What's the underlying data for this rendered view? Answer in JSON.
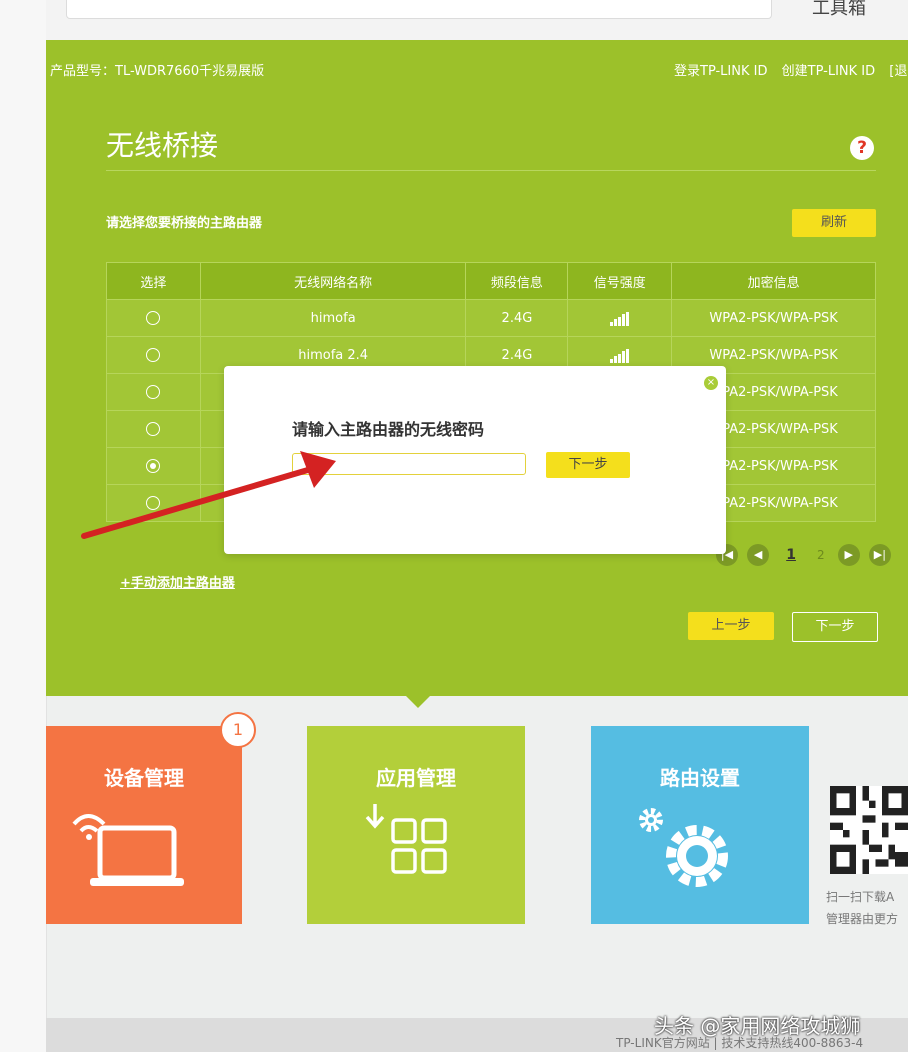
{
  "header": {
    "toolbox_label": "工具箱",
    "model": "产品型号：TL-WDR7660千兆易展版",
    "login_links": [
      "登录TP-LINK ID",
      "创建TP-LINK ID",
      "[退"
    ]
  },
  "main": {
    "title": "无线桥接",
    "help_icon": "?",
    "instruction": "请选择您要桥接的主路由器",
    "refresh_label": "刷新",
    "table": {
      "headers": [
        "选择",
        "无线网络名称",
        "频段信息",
        "信号强度",
        "加密信息"
      ],
      "rows": [
        {
          "ssid": "himofa",
          "band": "2.4G",
          "security": "WPA2-PSK/WPA-PSK",
          "signal": 5,
          "selected": false
        },
        {
          "ssid": "himofa 2.4",
          "band": "2.4G",
          "security": "WPA2-PSK/WPA-PSK",
          "signal": 5,
          "selected": false
        },
        {
          "ssid": "",
          "band": "",
          "security": "WPA2-PSK/WPA-PSK",
          "signal": 0,
          "selected": false
        },
        {
          "ssid": "",
          "band": "",
          "security": "WPA2-PSK/WPA-PSK",
          "signal": 0,
          "selected": false
        },
        {
          "ssid": "",
          "band": "",
          "security": "WPA2-PSK/WPA-PSK",
          "signal": 0,
          "selected": true
        },
        {
          "ssid": "",
          "band": "",
          "security": "WPA2-PSK/WPA-PSK",
          "signal": 0,
          "selected": false
        }
      ]
    },
    "pagination": {
      "current": "1",
      "other": "2",
      "first": "|◀",
      "prev": "◀",
      "next": "▶",
      "last": "▶|"
    },
    "manual_add": "+手动添加主路由器",
    "prev_step": "上一步",
    "next_step": "下一步"
  },
  "modal": {
    "title": "请输入主路由器的无线密码",
    "password_value": "",
    "password_placeholder": "",
    "next_label": "下一步",
    "close_icon": "×"
  },
  "tiles": [
    {
      "label": "设备管理",
      "badge": "1",
      "icon": "laptop-wifi-icon"
    },
    {
      "label": "应用管理",
      "icon": "apps-grid-icon"
    },
    {
      "label": "路由设置",
      "icon": "gear-icon"
    }
  ],
  "qr": {
    "line1": "扫一扫下载A",
    "line2": "管理器由更方"
  },
  "footer": {
    "text": "TP-LINK官方网站  |  技术支持热线400-8863-4"
  },
  "watermark": "头条 @家用网络攻城狮",
  "colors": {
    "green": "#9cc12a",
    "yellow": "#f4df1c",
    "orange": "#f47443",
    "lime": "#b3cf3a",
    "blue": "#55bde2",
    "arrow": "#d42222"
  }
}
